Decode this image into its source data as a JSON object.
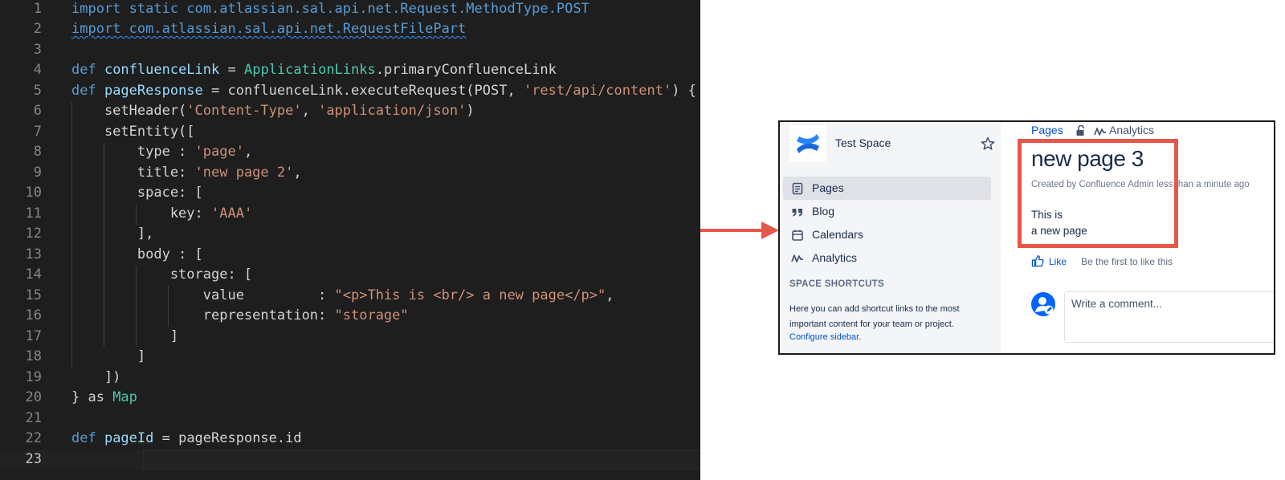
{
  "editor": {
    "line_numbers": [
      "1",
      "2",
      "3",
      "4",
      "5",
      "6",
      "7",
      "8",
      "9",
      "10",
      "11",
      "12",
      "13",
      "14",
      "15",
      "16",
      "17",
      "18",
      "19",
      "20",
      "21",
      "22",
      "23"
    ],
    "lines": [
      {
        "tokens": [
          {
            "t": "import static com.atlassian.sal.api.net.Request.MethodType.POST",
            "c": "imp"
          }
        ]
      },
      {
        "tokens": [
          {
            "t": "import com.atlassian.sal.api.net.RequestFilePart",
            "c": "imp squiggle"
          }
        ]
      },
      {
        "tokens": []
      },
      {
        "tokens": [
          {
            "t": "def ",
            "c": "kw"
          },
          {
            "t": "confluenceLink",
            "c": "var"
          },
          {
            "t": " = ",
            "c": "pln"
          },
          {
            "t": "ApplicationLinks",
            "c": "cls"
          },
          {
            "t": ".primaryConfluenceLink",
            "c": "pln"
          }
        ]
      },
      {
        "tokens": [
          {
            "t": "def ",
            "c": "kw"
          },
          {
            "t": "pageResponse",
            "c": "var"
          },
          {
            "t": " = confluenceLink.executeRequest(POST, ",
            "c": "pln"
          },
          {
            "t": "'rest/api/content'",
            "c": "str"
          },
          {
            "t": ") {",
            "c": "pln"
          }
        ]
      },
      {
        "tokens": [
          {
            "t": "    setHeader(",
            "c": "pln"
          },
          {
            "t": "'Content-Type'",
            "c": "str"
          },
          {
            "t": ", ",
            "c": "pln"
          },
          {
            "t": "'application/json'",
            "c": "str"
          },
          {
            "t": ")",
            "c": "pln"
          }
        ]
      },
      {
        "tokens": [
          {
            "t": "    setEntity([",
            "c": "pln"
          }
        ]
      },
      {
        "tokens": [
          {
            "t": "        type : ",
            "c": "pln"
          },
          {
            "t": "'page'",
            "c": "str"
          },
          {
            "t": ",",
            "c": "pln"
          }
        ]
      },
      {
        "tokens": [
          {
            "t": "        title: ",
            "c": "pln"
          },
          {
            "t": "'new page 2'",
            "c": "str"
          },
          {
            "t": ",",
            "c": "pln"
          }
        ]
      },
      {
        "tokens": [
          {
            "t": "        space: [",
            "c": "pln"
          }
        ]
      },
      {
        "tokens": [
          {
            "t": "            key: ",
            "c": "pln"
          },
          {
            "t": "'AAA'",
            "c": "str"
          }
        ]
      },
      {
        "tokens": [
          {
            "t": "        ],",
            "c": "pln"
          }
        ]
      },
      {
        "tokens": [
          {
            "t": "        body : [",
            "c": "pln"
          }
        ]
      },
      {
        "tokens": [
          {
            "t": "            storage: [",
            "c": "pln"
          }
        ]
      },
      {
        "tokens": [
          {
            "t": "                value         : ",
            "c": "pln"
          },
          {
            "t": "\"<p>This is <br/> a new page</p>\"",
            "c": "str"
          },
          {
            "t": ",",
            "c": "pln"
          }
        ]
      },
      {
        "tokens": [
          {
            "t": "                representation: ",
            "c": "pln"
          },
          {
            "t": "\"storage\"",
            "c": "str"
          }
        ]
      },
      {
        "tokens": [
          {
            "t": "            ]",
            "c": "pln"
          }
        ]
      },
      {
        "tokens": [
          {
            "t": "        ]",
            "c": "pln"
          }
        ]
      },
      {
        "tokens": [
          {
            "t": "    ])",
            "c": "pln"
          }
        ]
      },
      {
        "tokens": [
          {
            "t": "} as ",
            "c": "pln"
          },
          {
            "t": "Map",
            "c": "cls"
          }
        ]
      },
      {
        "tokens": []
      },
      {
        "tokens": [
          {
            "t": "def ",
            "c": "kw"
          },
          {
            "t": "pageId",
            "c": "var"
          },
          {
            "t": " = pageResponse.id",
            "c": "pln"
          }
        ]
      },
      {
        "tokens": []
      }
    ],
    "current_line": 23
  },
  "confluence": {
    "space_name": "Test Space",
    "sidebar_items": [
      {
        "label": "Pages",
        "icon": "page-icon",
        "active": true
      },
      {
        "label": "Blog",
        "icon": "quote-icon",
        "active": false
      },
      {
        "label": "Calendars",
        "icon": "calendar-icon",
        "active": false
      },
      {
        "label": "Analytics",
        "icon": "analytics-icon",
        "active": false
      }
    ],
    "shortcuts_title": "SPACE SHORTCUTS",
    "shortcuts_text": "Here you can add shortcut links to the most important content for your team or project.",
    "configure_link": "Configure sidebar.",
    "topnav_pages": "Pages",
    "topnav_analytics": "Analytics",
    "page_title": "new page 3",
    "byline": "Created by Confluence Admin less than a minute ago",
    "body_line_1": "This is",
    "body_line_2": "a new page",
    "like_label": "Like",
    "like_hint": "Be the first to like this",
    "comment_placeholder": "Write a comment..."
  },
  "colors": {
    "editor_bg": "#1e1e1e",
    "keyword": "#569cd6",
    "variable": "#9cdcfe",
    "class": "#4ec9b0",
    "string": "#ce9178",
    "highlight": "#e5574a",
    "link": "#0052cc"
  }
}
